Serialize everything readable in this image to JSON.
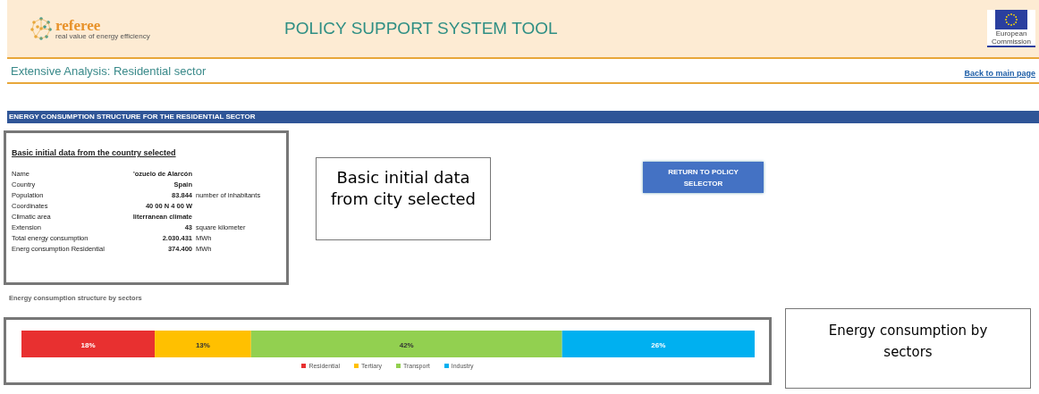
{
  "header": {
    "logo": {
      "name": "referee",
      "tagline": "real value of energy efficiency"
    },
    "title": "POLICY SUPPORT SYSTEM TOOL",
    "eu_logo": {
      "text": "European Commission"
    }
  },
  "subheader": {
    "title": "Extensive Analysis: Residential sector",
    "link": "Back to main page"
  },
  "section_bar": "ENERGY CONSUMPTION STRUCTURE FOR THE RESIDENTIAL SECTOR",
  "data_panel": {
    "title": "Basic initial data from the country selected",
    "rows": [
      {
        "label": "Name",
        "value": "'ozuelo de Alarcón"
      },
      {
        "label": "Country",
        "value": "Spain"
      },
      {
        "label": "Population",
        "value": "83.844",
        "unit": "number of inhabitants"
      },
      {
        "label": "Coordinates",
        "value": "40 00 N 4 00 W"
      },
      {
        "label": "Climatic area",
        "value": "literranean climate"
      },
      {
        "label": "Extension",
        "value": "43",
        "unit": "square kilometer"
      },
      {
        "label": "Total energy consumption",
        "value": "2.030.431",
        "unit": "MWh"
      },
      {
        "label": "Energ consumption Residential",
        "value": "374.400",
        "unit": "MWh"
      }
    ]
  },
  "callout_1": "Basic initial data from city selected",
  "return_button": "RETURN TO POLICY SELECTOR",
  "chart_heading": "Energy consumption structure by sectors",
  "chart": {
    "chart_data": {
      "type": "bar",
      "orientation": "horizontal",
      "stacked": true,
      "legend": "bottom",
      "series": [
        {
          "name": "Residential",
          "color": "#e83030",
          "values": [
            18
          ],
          "value_labels": [
            "18%"
          ]
        },
        {
          "name": "Tertiary",
          "color": "#ffc000",
          "values": [
            13
          ],
          "value_labels": [
            "13%"
          ]
        },
        {
          "name": "Transport",
          "color": "#92d050",
          "values": [
            42
          ],
          "value_labels": [
            "42%"
          ]
        },
        {
          "name": "Industry",
          "color": "#00b0f0",
          "values": [
            26
          ],
          "value_labels": [
            "26%"
          ]
        }
      ]
    }
  },
  "callout_2": "Energy consumption by sectors"
}
